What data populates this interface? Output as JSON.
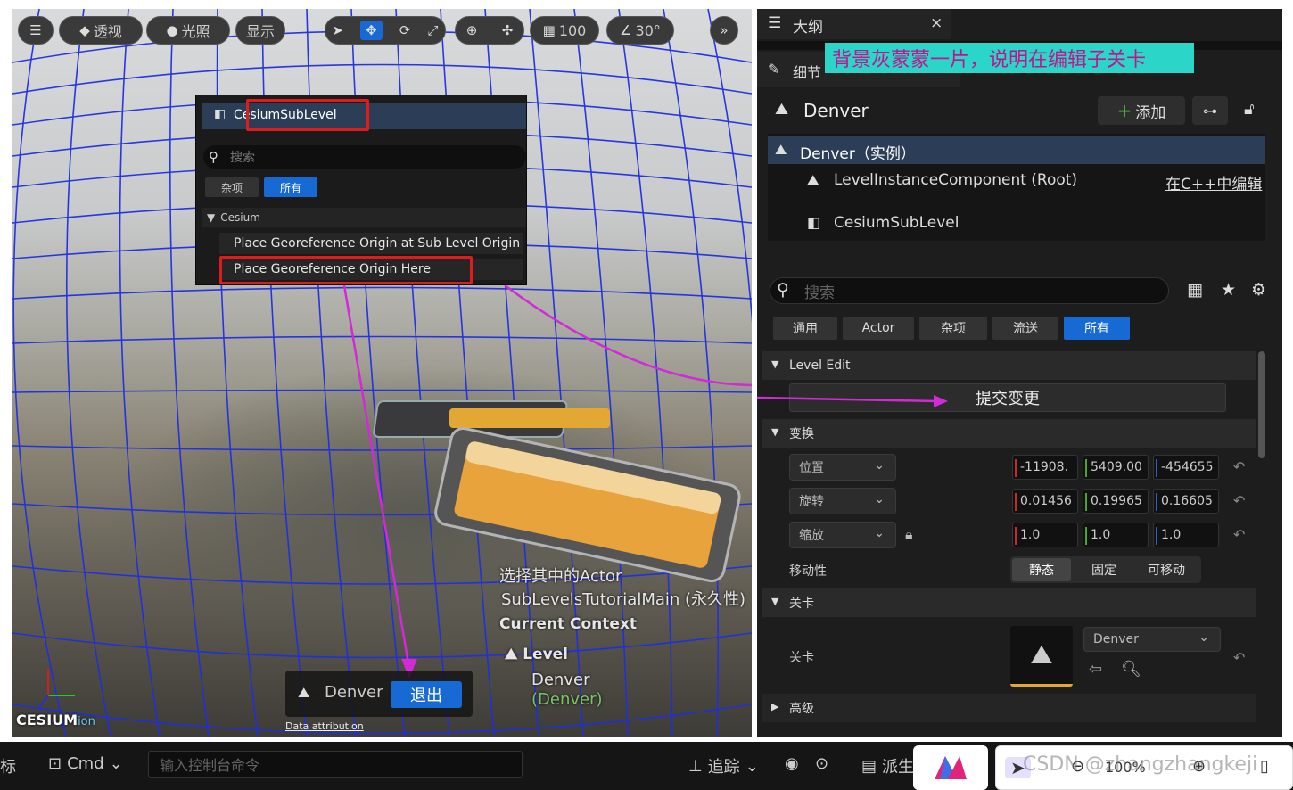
{
  "toolbar": {
    "perspective": "透视",
    "lighting": "光照",
    "show": "显示",
    "grid_snap": "100",
    "angle_snap": "30°"
  },
  "popup": {
    "header": "CesiumSubLevel",
    "search_placeholder": "搜索",
    "chip_misc": "杂项",
    "chip_all": "所有",
    "category": "Cesium",
    "item1": "Place Georeference Origin at Sub Level Origin",
    "item2": "Place Georeference Origin Here"
  },
  "viewport_overlay": {
    "line1": "选择其中的Actor",
    "line2": "SubLevelsTutorialMain (永久性)",
    "context_title": "Current Context",
    "level_label": "Level",
    "level_name": "Denver",
    "level_sub": "(Denver)",
    "logo": "CESIUM",
    "logo_suffix": "ion",
    "attribution": "Data attribution"
  },
  "exit_bar": {
    "name": "Denver",
    "exit": "退出"
  },
  "outline": {
    "title": "大纲",
    "close": "×"
  },
  "details": {
    "tab_title": "细节",
    "annotation": "背景灰蒙蒙一片，说明在编辑子关卡",
    "actor_name": "Denver",
    "add_label": "添加",
    "tree": [
      {
        "label": "Denver（实例）"
      },
      {
        "label": "LevelInstanceComponent (Root)",
        "link": "在C++中编辑"
      },
      {
        "label": "CesiumSubLevel"
      }
    ],
    "search_placeholder": "搜索",
    "filters": [
      "通用",
      "Actor",
      "杂项",
      "流送",
      "所有"
    ],
    "level_edit": {
      "title": "Level Edit",
      "commit": "提交变更"
    },
    "transform": {
      "title": "变换",
      "location": {
        "label": "位置",
        "x": "-11908.",
        "y": "5409.00",
        "z": "-454655"
      },
      "rotation": {
        "label": "旋转",
        "x": "0.01456",
        "y": "0.19965",
        "z": "0.16605"
      },
      "scale": {
        "label": "缩放",
        "x": "1.0",
        "y": "1.0",
        "z": "1.0"
      },
      "mobility": {
        "label": "移动性",
        "options": [
          "静态",
          "固定",
          "可移动"
        ]
      }
    },
    "level": {
      "title": "关卡",
      "label": "关卡",
      "value": "Denver"
    },
    "advanced": "高级"
  },
  "bottombar": {
    "left_char": "标",
    "cmd": "Cmd",
    "console_placeholder": "输入控制台命令",
    "trace": "追踪",
    "derive": "派生",
    "zoom": "100%",
    "watermark": "CSDN @zhangzhangkeji"
  },
  "colors": {
    "accent": "#0f6fd6",
    "annotation_bg": "#2bd5c8",
    "annotation_fg": "#c0148f",
    "red": "#e01b1b",
    "arrow": "#d12ad6"
  }
}
